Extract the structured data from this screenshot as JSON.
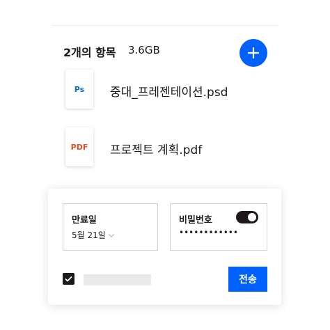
{
  "header": {
    "count_label": "2개의 항목",
    "size_label": "3.6GB"
  },
  "files": [
    {
      "name": "중대_프레젠테이션.psd",
      "type_badge": "Ps",
      "icon": "photoshop-file-icon",
      "badge_color": "#0a6fc2"
    },
    {
      "name": "프로젝트 계획.pdf",
      "type_badge": "PDF",
      "icon": "pdf-file-icon",
      "badge_color": "#e2501d"
    }
  ],
  "share": {
    "expiry_label": "만료일",
    "expiry_value": "5월 21일",
    "password_label": "비밀번호",
    "password_value": "••••••••••••",
    "password_enabled": true,
    "checkbox_checked": true,
    "send_label": "전송"
  },
  "colors": {
    "accent": "#0061fe",
    "text": "#1e1919"
  }
}
